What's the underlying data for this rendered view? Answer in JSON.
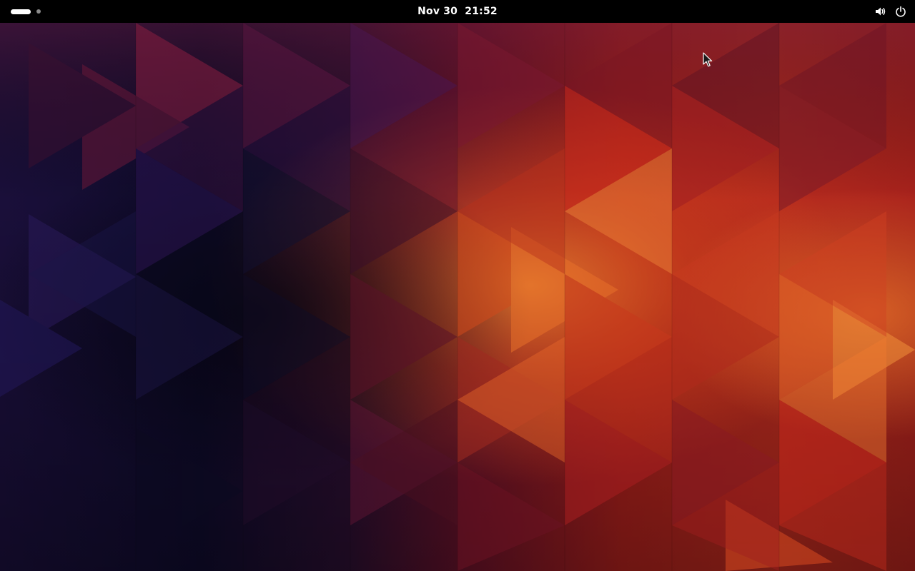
{
  "topbar": {
    "date": "Nov 30",
    "time": "21:52",
    "workspace_indicator": {
      "workspaces": 2,
      "active_index": 0
    },
    "status_icons": [
      "volume-icon",
      "power-icon"
    ],
    "background_color": "#000000",
    "text_color": "#ffffff"
  },
  "desktop": {
    "wallpaper": "geometric-triangles-wallpaper",
    "palette": [
      "#0b0a22",
      "#2b1040",
      "#6e1430",
      "#b8201e",
      "#e0561a",
      "#f0903a"
    ]
  },
  "pointer": {
    "icon": "mouse-pointer-icon"
  }
}
